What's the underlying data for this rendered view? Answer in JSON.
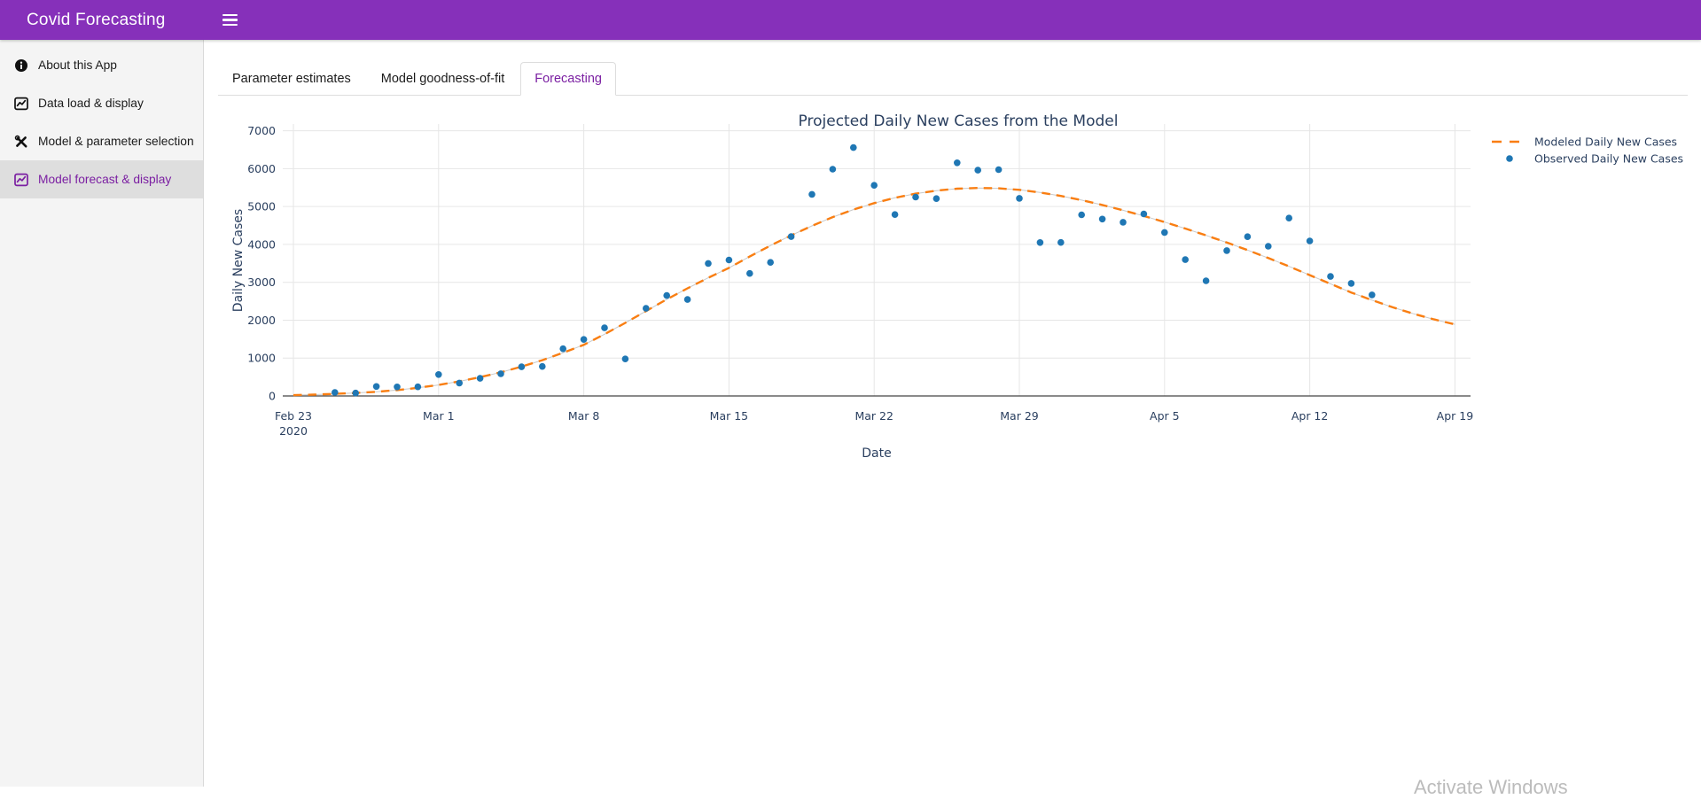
{
  "header": {
    "app_title": "Covid Forecasting"
  },
  "sidebar": {
    "items": [
      {
        "label": "About this App",
        "icon": "info-circle-icon",
        "active": false
      },
      {
        "label": "Data load & display",
        "icon": "chart-line-icon",
        "active": false
      },
      {
        "label": "Model & parameter selection",
        "icon": "tools-icon",
        "active": false
      },
      {
        "label": "Model forecast & display",
        "icon": "chart-line-icon",
        "active": true
      }
    ]
  },
  "tabs": [
    {
      "label": "Parameter estimates",
      "active": false
    },
    {
      "label": "Model goodness-of-fit",
      "active": false
    },
    {
      "label": "Forecasting",
      "active": true
    }
  ],
  "watermark": "Activate Windows",
  "colors": {
    "header_bg": "#8630ba",
    "sidebar_bg": "#f4f4f4",
    "sidebar_active_bg": "#dedede",
    "active_purple": "#7b1fa2",
    "tab_border": "#dddddd",
    "modeled_orange": "#f97e12",
    "modeled_underlay": "#c9c9c9",
    "observed_blue": "#1f77b4",
    "chart_text": "#2a3f5f",
    "grid": "#e6e6e6",
    "zeroline": "#444444"
  },
  "chart_data": {
    "type": "scatter",
    "title": "Projected Daily New Cases from the Model",
    "xlabel": "Date",
    "ylabel": "Daily New Cases",
    "ylim": [
      0,
      7000
    ],
    "yticks": [
      0,
      1000,
      2000,
      3000,
      4000,
      5000,
      6000,
      7000
    ],
    "x_axis_start_date": "2020-02-23",
    "xticks": [
      {
        "label": "Feb 23",
        "sub": "2020",
        "day": 0
      },
      {
        "label": "Mar 1",
        "day": 7
      },
      {
        "label": "Mar 8",
        "day": 14
      },
      {
        "label": "Mar 15",
        "day": 21
      },
      {
        "label": "Mar 22",
        "day": 28
      },
      {
        "label": "Mar 29",
        "day": 35
      },
      {
        "label": "Apr 5",
        "day": 42
      },
      {
        "label": "Apr 12",
        "day": 49
      },
      {
        "label": "Apr 19",
        "day": 56
      }
    ],
    "grid": true,
    "legend_position": "right",
    "series": [
      {
        "name": "Modeled Daily New Cases",
        "type": "line",
        "dash": true,
        "color": "#f97e12",
        "start_date": "2020-02-23",
        "start_day": 0,
        "values": [
          20,
          35,
          55,
          80,
          110,
          155,
          215,
          290,
          385,
          495,
          625,
          775,
          945,
          1140,
          1350,
          1630,
          1930,
          2240,
          2550,
          2840,
          3120,
          3380,
          3680,
          3970,
          4240,
          4490,
          4720,
          4920,
          5090,
          5230,
          5340,
          5420,
          5470,
          5490,
          5480,
          5440,
          5370,
          5280,
          5170,
          5040,
          4900,
          4750,
          4590,
          4420,
          4240,
          4050,
          3850,
          3640,
          3420,
          3190,
          2960,
          2730,
          2530,
          2340,
          2170,
          2020,
          1890
        ]
      },
      {
        "name": "Observed Daily New Cases",
        "type": "scatter",
        "color": "#1f77b4",
        "start_date": "2020-02-25",
        "start_day": 2,
        "values": [
          93,
          78,
          250,
          238,
          240,
          566,
          342,
          466,
          587,
          769,
          778,
          1247,
          1492,
          1797,
          977,
          2313,
          2651,
          2547,
          3497,
          3590,
          3233,
          3526,
          4207,
          5322,
          5986,
          6557,
          5560,
          4789,
          5249,
          5210,
          6153,
          5959,
          5974,
          5217,
          4050,
          4053,
          4782,
          4668,
          4585,
          4805,
          4316,
          3599,
          3039,
          3836,
          4204,
          3951,
          4694,
          4092,
          3153,
          2972,
          2667
        ]
      }
    ]
  }
}
